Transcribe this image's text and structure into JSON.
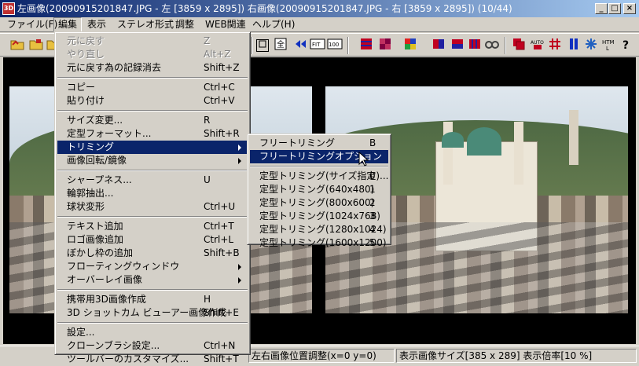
{
  "window": {
    "title": "左画像(20090915201847.JPG - 左 [3859 x 2895]) 右画像(20090915201847.JPG - 右 [3859 x 2895])  (10/44)",
    "app_icon_label": "3D",
    "minimize": "_",
    "maximize": "□",
    "close": "×"
  },
  "menubar": [
    "ファイル(F)",
    "編集",
    "表示",
    "ステレオ形式",
    "調整",
    "WEB関連",
    "ヘルプ(H)"
  ],
  "toolbar_icons": {
    "fit": "FIT",
    "zoom100": "100",
    "web": "HTML",
    "help": "?"
  },
  "edit_menu": [
    {
      "label": "元に戻す",
      "shortcut": "Z",
      "disabled": true
    },
    {
      "label": "やり直し",
      "shortcut": "Alt+Z",
      "disabled": true
    },
    {
      "label": "元に戻す為の記録消去",
      "shortcut": "Shift+Z"
    },
    {
      "sep": true
    },
    {
      "label": "コピー",
      "shortcut": "Ctrl+C"
    },
    {
      "label": "貼り付け",
      "shortcut": "Ctrl+V"
    },
    {
      "sep": true
    },
    {
      "label": "サイズ変更...",
      "shortcut": "R"
    },
    {
      "label": "定型フォーマット...",
      "shortcut": "Shift+R"
    },
    {
      "label": "トリミング",
      "shortcut": "",
      "submenu": true,
      "highlight": true
    },
    {
      "label": "画像回転/鏡像",
      "shortcut": "",
      "submenu": true
    },
    {
      "sep": true
    },
    {
      "label": "シャープネス...",
      "shortcut": "U"
    },
    {
      "label": "輪郭抽出...",
      "shortcut": ""
    },
    {
      "label": "球状変形",
      "shortcut": "Ctrl+U"
    },
    {
      "sep": true
    },
    {
      "label": "テキスト追加",
      "shortcut": "Ctrl+T"
    },
    {
      "label": "ロゴ画像追加",
      "shortcut": "Ctrl+L"
    },
    {
      "label": "ぼかし枠の追加",
      "shortcut": "Shift+B"
    },
    {
      "label": "フローティングウィンドウ",
      "shortcut": "",
      "submenu": true
    },
    {
      "label": "オーバーレイ画像",
      "shortcut": "",
      "submenu": true
    },
    {
      "sep": true
    },
    {
      "label": "携帯用3D画像作成",
      "shortcut": "H"
    },
    {
      "label": "3D ショットカム ビューアー画像作成",
      "shortcut": "Shift+E"
    },
    {
      "sep": true
    },
    {
      "label": "設定...",
      "shortcut": ""
    },
    {
      "label": "クローンブラシ設定...",
      "shortcut": "Ctrl+N"
    },
    {
      "label": "ツールバーのカスタマイズ...",
      "shortcut": "Shift+T"
    }
  ],
  "trim_submenu": [
    {
      "label": "フリートリミング",
      "shortcut": "B"
    },
    {
      "label": "フリートリミングオプション",
      "shortcut": "",
      "highlight": true
    },
    {
      "sep": true
    },
    {
      "label": "定型トリミング(サイズ指定)...",
      "shortcut": "0"
    },
    {
      "label": "定型トリミング(640x480)",
      "shortcut": "1"
    },
    {
      "label": "定型トリミング(800x600)",
      "shortcut": "2"
    },
    {
      "label": "定型トリミング(1024x768)",
      "shortcut": "3"
    },
    {
      "label": "定型トリミング(1280x1024)",
      "shortcut": "4"
    },
    {
      "label": "定型トリミング(1600x1200)",
      "shortcut": "5"
    }
  ],
  "status": {
    "position": "左右画像位置調整(x=0 y=0)",
    "size": "表示画像サイズ[385 x 289]  表示倍率[10 %]"
  },
  "colors": {
    "title_start": "#0a246a",
    "title_end": "#a6caf0",
    "highlight": "#0a246a",
    "face": "#d4d0c8"
  }
}
